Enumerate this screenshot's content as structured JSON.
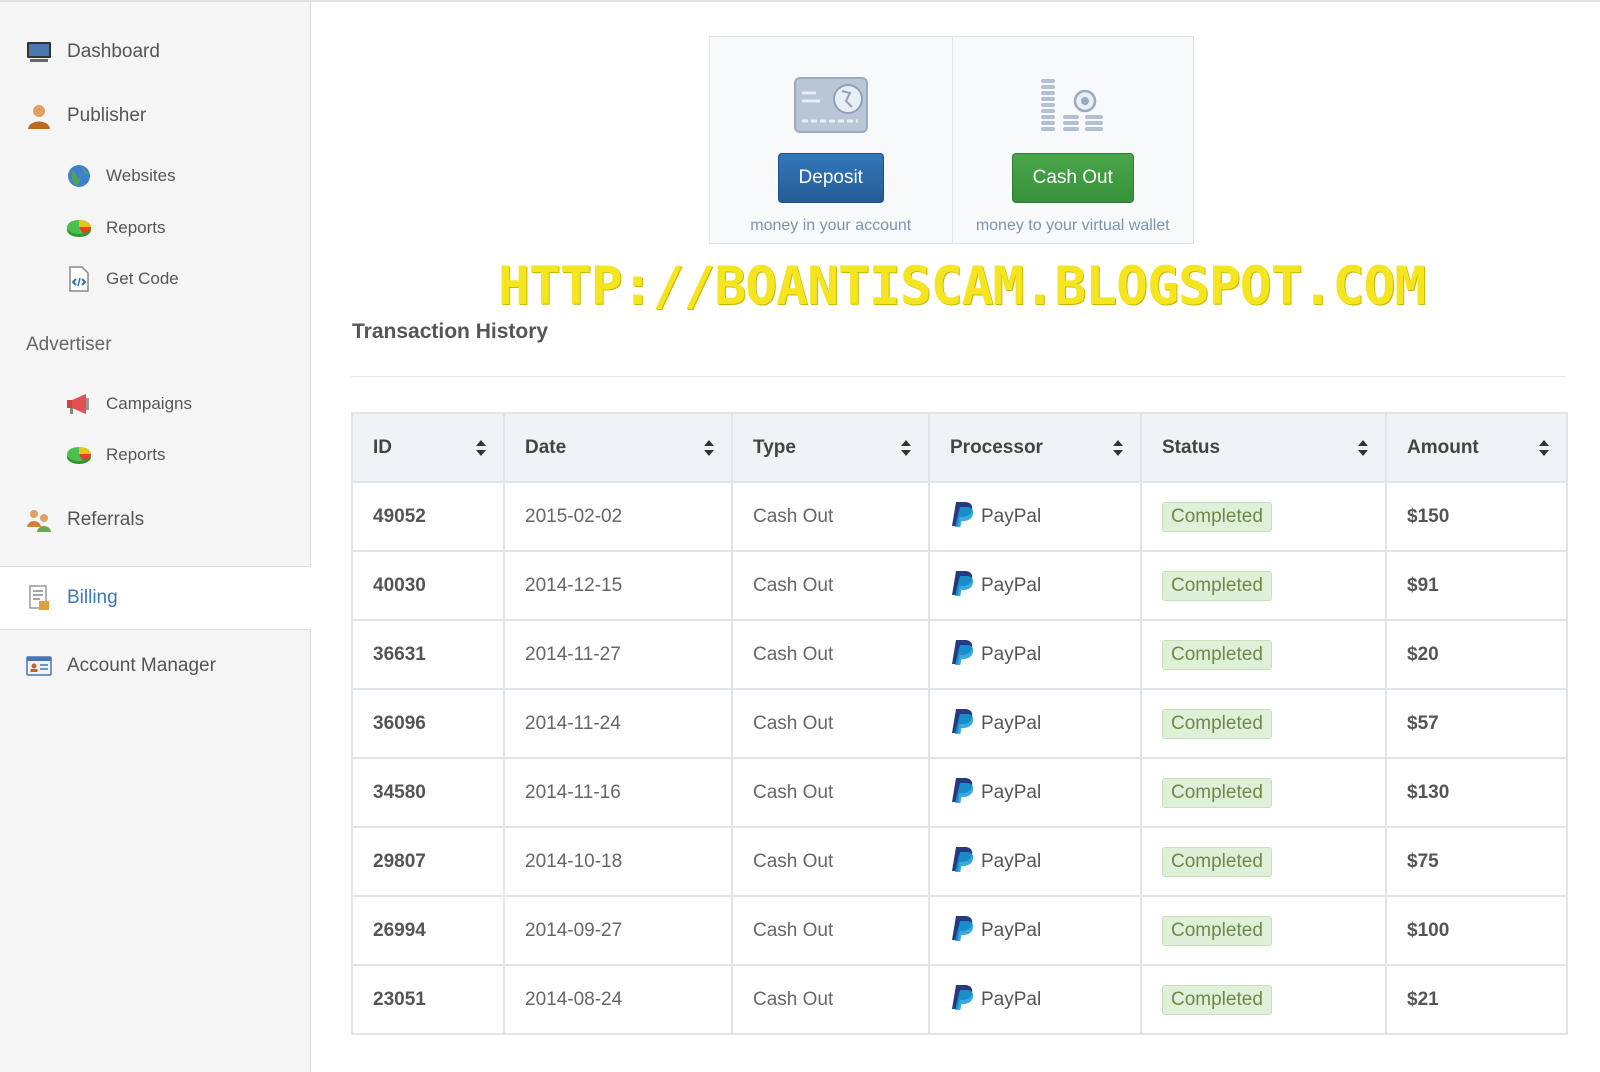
{
  "sidebar": {
    "items": [
      {
        "label": "Dashboard",
        "icon": "monitor-icon"
      },
      {
        "label": "Publisher",
        "icon": "user-icon"
      },
      {
        "label": "Websites",
        "icon": "globe-icon"
      },
      {
        "label": "Reports",
        "icon": "chart-icon"
      },
      {
        "label": "Get Code",
        "icon": "code-file-icon"
      },
      {
        "label": "Campaigns",
        "icon": "megaphone-icon"
      },
      {
        "label": "Reports",
        "icon": "chart-icon"
      },
      {
        "label": "Referrals",
        "icon": "people-icon"
      },
      {
        "label": "Billing",
        "icon": "invoice-icon"
      },
      {
        "label": "Account Manager",
        "icon": "id-card-icon"
      }
    ],
    "advertiser_heading": "Advertiser"
  },
  "actions": {
    "deposit": {
      "label": "Deposit",
      "caption": "money in your account",
      "icon": "credit-card-icon"
    },
    "cashout": {
      "label": "Cash Out",
      "caption": "money to your virtual wallet",
      "icon": "coins-icon"
    }
  },
  "watermark": "HTTP://BOANTISCAM.BLOGSPOT.COM",
  "transactions": {
    "title": "Transaction History",
    "columns": [
      "ID",
      "Date",
      "Type",
      "Processor",
      "Status",
      "Amount"
    ],
    "rows": [
      {
        "id": "49052",
        "date": "2015-02-02",
        "type": "Cash Out",
        "processor": "PayPal",
        "status": "Completed",
        "amount": "$150"
      },
      {
        "id": "40030",
        "date": "2014-12-15",
        "type": "Cash Out",
        "processor": "PayPal",
        "status": "Completed",
        "amount": "$91"
      },
      {
        "id": "36631",
        "date": "2014-11-27",
        "type": "Cash Out",
        "processor": "PayPal",
        "status": "Completed",
        "amount": "$20"
      },
      {
        "id": "36096",
        "date": "2014-11-24",
        "type": "Cash Out",
        "processor": "PayPal",
        "status": "Completed",
        "amount": "$57"
      },
      {
        "id": "34580",
        "date": "2014-11-16",
        "type": "Cash Out",
        "processor": "PayPal",
        "status": "Completed",
        "amount": "$130"
      },
      {
        "id": "29807",
        "date": "2014-10-18",
        "type": "Cash Out",
        "processor": "PayPal",
        "status": "Completed",
        "amount": "$75"
      },
      {
        "id": "26994",
        "date": "2014-09-27",
        "type": "Cash Out",
        "processor": "PayPal",
        "status": "Completed",
        "amount": "$100"
      },
      {
        "id": "23051",
        "date": "2014-08-24",
        "type": "Cash Out",
        "processor": "PayPal",
        "status": "Completed",
        "amount": "$21"
      }
    ]
  },
  "colors": {
    "deposit_button": "#2a69a8",
    "cashout_button": "#3f9c40",
    "status_badge": "#dff0d8",
    "active_nav": "#3b78b8",
    "watermark": "#f5e51f"
  }
}
